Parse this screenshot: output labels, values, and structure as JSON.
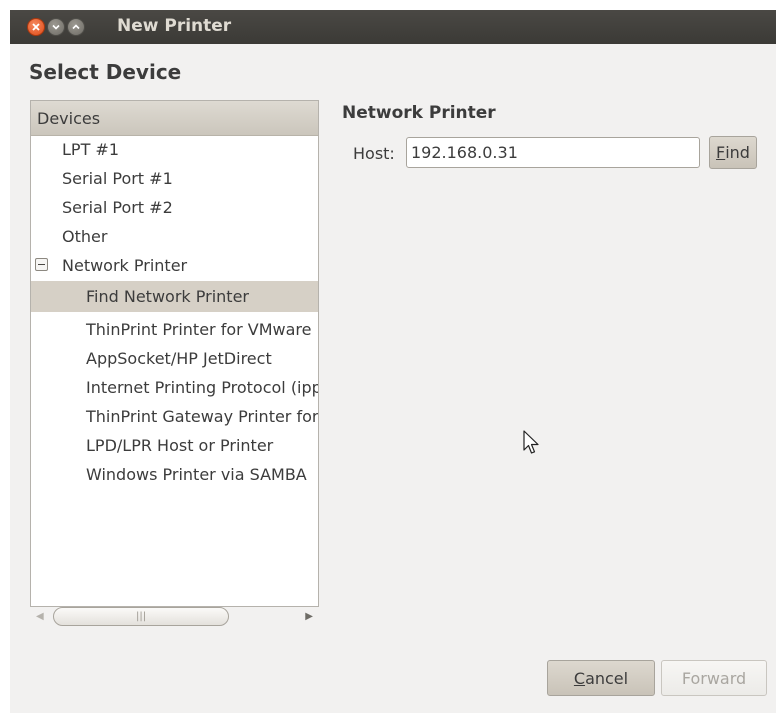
{
  "window": {
    "title": "New Printer"
  },
  "heading": "Select Device",
  "devices": {
    "header": "Devices",
    "items": [
      {
        "label": "LPT #1"
      },
      {
        "label": "Serial Port #1"
      },
      {
        "label": "Serial Port #2"
      },
      {
        "label": "Other"
      },
      {
        "label": "Network Printer",
        "expanded": true
      },
      {
        "label": "Find Network Printer",
        "selected": true
      },
      {
        "label": "ThinPrint Printer for VMware"
      },
      {
        "label": "AppSocket/HP JetDirect"
      },
      {
        "label": "Internet Printing Protocol (ipp)"
      },
      {
        "label": "ThinPrint Gateway Printer for VMware"
      },
      {
        "label": "LPD/LPR Host or Printer"
      },
      {
        "label": "Windows Printer via SAMBA"
      }
    ]
  },
  "network_printer": {
    "heading": "Network Printer",
    "host_label": "Host:",
    "host_value": "192.168.0.31",
    "find_label_mnemonic": "F",
    "find_label_rest": "ind"
  },
  "buttons": {
    "cancel_mnemonic": "C",
    "cancel_rest": "ancel",
    "forward_label": "Forward",
    "forward_enabled": false
  },
  "colors": {
    "titlebar": "#3c3b37",
    "window_bg": "#f2f1f0",
    "close_button": "#df4a16",
    "selection": "#d6d0c6"
  }
}
